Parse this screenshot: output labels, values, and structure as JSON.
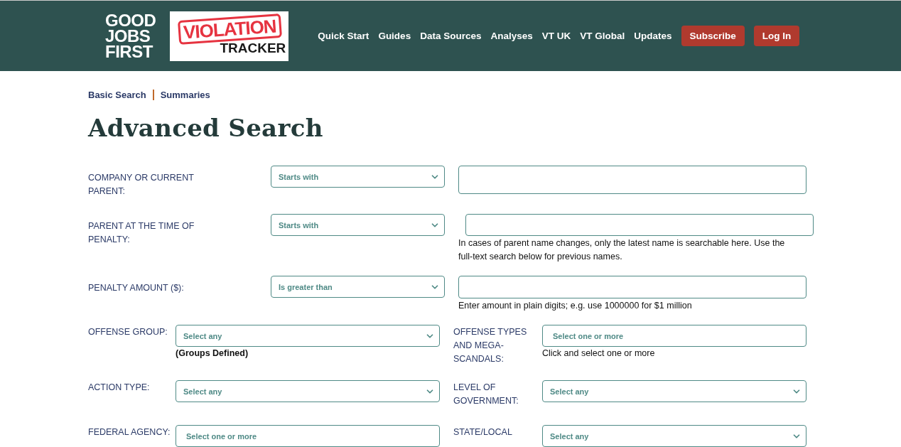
{
  "logo": {
    "lines": [
      "GOOD",
      "JOBS",
      "FIRST"
    ],
    "stamp": "VIOLATION",
    "subtitle": "TRACKER"
  },
  "nav": {
    "links": [
      "Quick Start",
      "Guides",
      "Data Sources",
      "Analyses",
      "VT UK",
      "VT Global",
      "Updates"
    ],
    "buttons": [
      "Subscribe",
      "Log In"
    ]
  },
  "breadcrumb": [
    "Basic Search",
    "Summaries"
  ],
  "title": "Advanced Search",
  "rows": [
    {
      "kind": "triple",
      "label": "COMPANY OR CURRENT PARENT:",
      "select": "Starts with",
      "shifted": false
    },
    {
      "kind": "triple",
      "label": "PARENT AT THE TIME OF PENALTY:",
      "select": "Starts with",
      "shifted": true,
      "hint": "In cases of parent name changes, only the latest name is searchable here. Use the full-text search below for previous names."
    },
    {
      "kind": "triple",
      "label": "PENALTY AMOUNT ($):",
      "select": "Is greater than",
      "shifted": false,
      "hint": "Enter amount in plain digits; e.g. use 1000000 for $1 million"
    },
    {
      "kind": "pair",
      "fields": [
        {
          "label": "OFFENSE GROUP:",
          "kind": "dropdown",
          "value": "Select any",
          "note": "(Groups Defined)",
          "note_bold": true
        },
        {
          "label": "OFFENSE TYPES AND MEGA-SCANDALS:",
          "kind": "multiselect",
          "value": "Select one or more",
          "note": "Click and select one or more",
          "note_bold": false
        }
      ]
    },
    {
      "kind": "pair",
      "fields": [
        {
          "label": "ACTION TYPE:",
          "kind": "dropdown",
          "value": "Select any"
        },
        {
          "label": "LEVEL OF GOVERNMENT:",
          "kind": "dropdown",
          "value": "Select any"
        }
      ]
    },
    {
      "kind": "pair",
      "fields": [
        {
          "label": "FEDERAL AGENCY:",
          "kind": "multiselect",
          "value": "Select one or more"
        },
        {
          "label": "STATE/LOCAL",
          "kind": "dropdown",
          "value": "Select any"
        }
      ]
    }
  ]
}
